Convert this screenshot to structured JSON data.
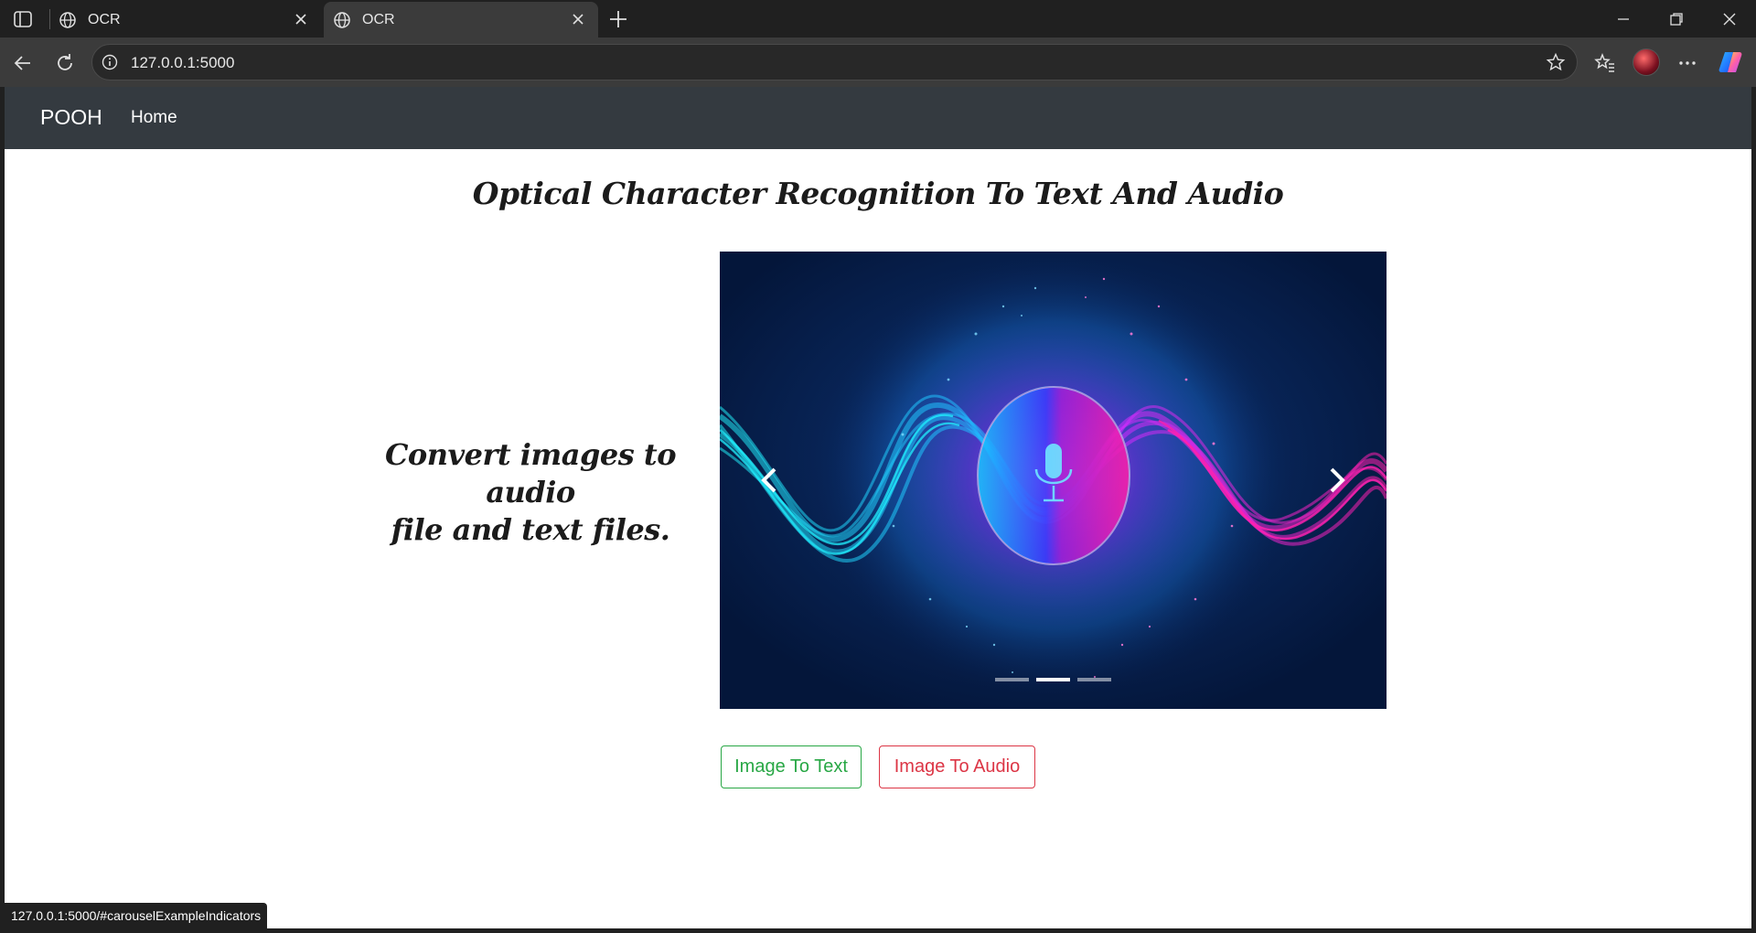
{
  "browser": {
    "tabs": [
      {
        "title": "OCR",
        "active": false
      },
      {
        "title": "OCR",
        "active": true
      }
    ],
    "url": "127.0.0.1:5000",
    "status_url": "127.0.0.1:5000/#carouselExampleIndicators"
  },
  "navbar": {
    "brand": "POOH",
    "links": [
      {
        "label": "Home"
      }
    ]
  },
  "main": {
    "heading": "Optical Character Recognition To Text And Audio",
    "tagline_line1": "Convert images to audio",
    "tagline_line2": "file and text files.",
    "carousel": {
      "slide_count": 3,
      "active_index": 1,
      "image": "microphone-sound-wave",
      "colors": {
        "background": "#061a3a",
        "cyan": "#19e6f0",
        "magenta": "#ff1ea8"
      }
    },
    "buttons": {
      "to_text": "Image To Text",
      "to_audio": "Image To Audio"
    }
  },
  "colors": {
    "navbar": "#343a40",
    "success": "#28a745",
    "danger": "#dc3545"
  }
}
